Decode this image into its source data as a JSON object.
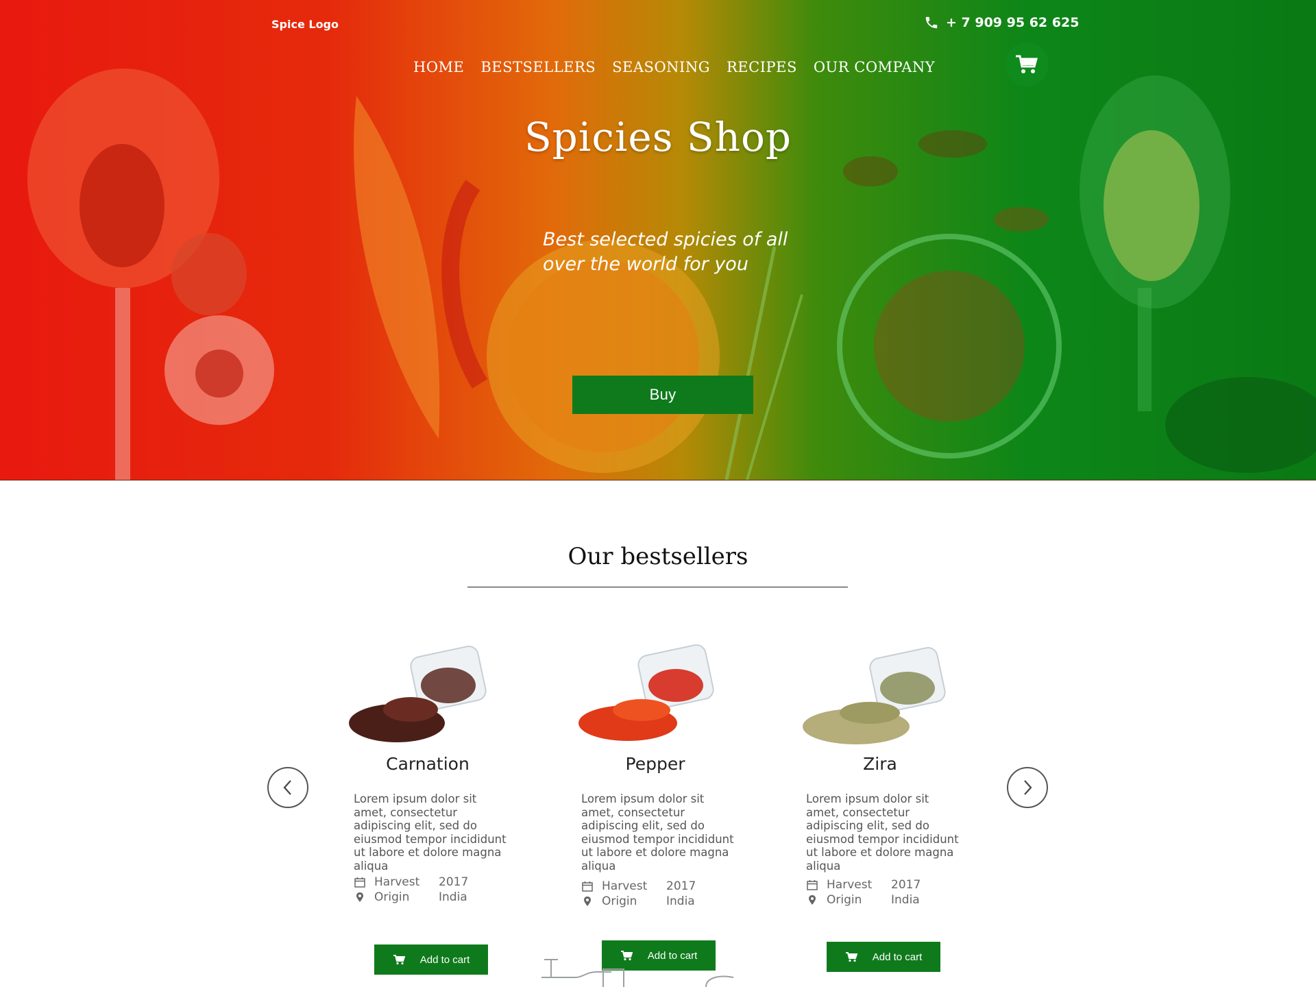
{
  "header": {
    "logo": "Spice Logo",
    "phone": "+ 7 909 95 62 625",
    "nav": [
      "HOME",
      "BESTSELLERS",
      "SEASONING",
      "RECIPES",
      "OUR COMPANY"
    ]
  },
  "hero": {
    "title": "Spicies Shop",
    "subtitle": "Best selected spicies of all over the world for you",
    "buy_label": "Buy"
  },
  "bestsellers": {
    "title": "Our bestsellers",
    "products": [
      {
        "name": "Carnation",
        "description": "Lorem ipsum dolor sit amet, consectetur adipiscing elit, sed do eiusmod tempor incididunt ut labore et dolore magna aliqua",
        "harvest_label": "Harvest",
        "harvest": "2017",
        "origin_label": "Origin",
        "origin": "India",
        "cart_label": "Add to cart"
      },
      {
        "name": "Pepper",
        "description": "Lorem ipsum dolor sit amet, consectetur adipiscing elit, sed do eiusmod tempor incididunt ut labore et dolore magna aliqua",
        "harvest_label": "Harvest",
        "harvest": "2017",
        "origin_label": "Origin",
        "origin": "India",
        "cart_label": "Add to cart"
      },
      {
        "name": "Zira",
        "description": "Lorem ipsum dolor sit amet, consectetur adipiscing elit, sed do eiusmod tempor incididunt ut labore et dolore magna aliqua",
        "harvest_label": "Harvest",
        "harvest": "2017",
        "origin_label": "Origin",
        "origin": "India",
        "cart_label": "Add to cart"
      }
    ]
  },
  "icons": {
    "phone": "phone-icon",
    "cart": "cart-icon",
    "prev": "chevron-left-icon",
    "next": "chevron-right-icon",
    "calendar": "calendar-icon",
    "location": "map-pin-icon"
  },
  "colors": {
    "accent_green": "#0f7a1c",
    "hero_red": "#e8190f",
    "hero_green": "#0d8618"
  }
}
